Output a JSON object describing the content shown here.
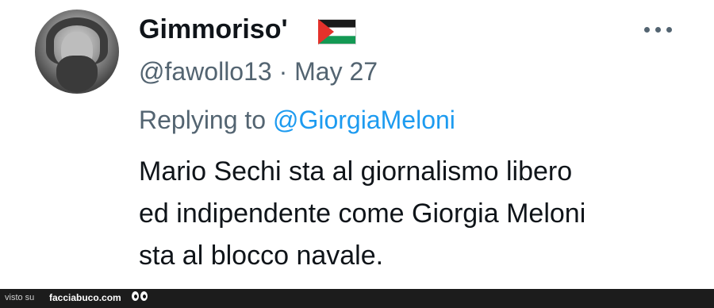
{
  "tweet": {
    "display_name": "Gimmoriso'",
    "flag_icon": "palestine-flag-icon",
    "handle": "@fawollo13",
    "separator": "·",
    "date": "May 27",
    "meta_line": "@fawollo13 · May 27",
    "replying_prefix": "Replying to ",
    "replying_mention": "@GiorgiaMeloni",
    "text_lines": [
      "Mario Sechi sta al giornalismo libero",
      "ed indipendente come Giorgia Meloni",
      "sta al blocco navale."
    ],
    "more_icon": "more-options-icon"
  },
  "footer": {
    "visto_su": "visto su",
    "site": "facciabuco.com",
    "logo_icon": "eyes-logo-icon"
  },
  "colors": {
    "text": "#0f1419",
    "secondary": "#536471",
    "mention": "#1d9bf0",
    "footer_bg": "#1c1c1c"
  }
}
